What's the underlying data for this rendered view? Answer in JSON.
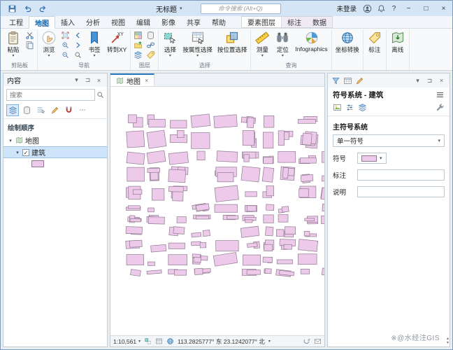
{
  "titlebar": {
    "title": "无标题",
    "search_placeholder": "命令搜索 (Alt+Q)",
    "login": "未登录"
  },
  "ribbon_tabs": {
    "main": [
      "工程",
      "地图",
      "插入",
      "分析",
      "视图",
      "编辑",
      "影像",
      "共享",
      "帮助"
    ],
    "contextual": [
      "要素图层",
      "标注",
      "数据"
    ]
  },
  "ribbon": {
    "groups": {
      "clipboard": "剪贴板",
      "navigate": "导航",
      "layer": "图层",
      "selection": "选择",
      "inquiry": "查询",
      "coordinate": "",
      "labeling": "",
      "offline": ""
    },
    "buttons": {
      "paste": "粘贴",
      "explore": "浏览",
      "bookmarks": "书签",
      "goto_xy": "转到XY",
      "select": "选择",
      "select_by_attributes": "按属性选择",
      "select_by_location": "按位置选择",
      "measure": "测量",
      "locate": "定位",
      "infographics": "Infographics",
      "coordinate_conversion": "坐标转换",
      "labeling": "标注",
      "offline": "离线"
    }
  },
  "contents_pane": {
    "title": "内容",
    "search_placeholder": "搜索",
    "section": "绘制顺序",
    "map_item": "地图",
    "layer_item": "建筑"
  },
  "map_view": {
    "tab": "地图",
    "scale": "1:10,561",
    "coordinates": "113.2825777° 东  23.1242077° 北"
  },
  "symbology_pane": {
    "title": "符号系统 - 建筑",
    "primary_section": "主符号系统",
    "symbol_type_value": "单一符号",
    "symbol_label": "符号",
    "label_label": "标注",
    "description_label": "说明"
  },
  "watermark": "※@水经注GIS",
  "map_render": {
    "building_fill": "#edc9ea",
    "building_stroke": "#8f7b91",
    "seed": 11
  },
  "glyphs": {
    "caret_down": "▾",
    "up": "▴",
    "close": "×",
    "minimize": "−",
    "maximize": "□",
    "help": "?",
    "pin": "⊐",
    "more": "⋯",
    "check": "✓"
  }
}
